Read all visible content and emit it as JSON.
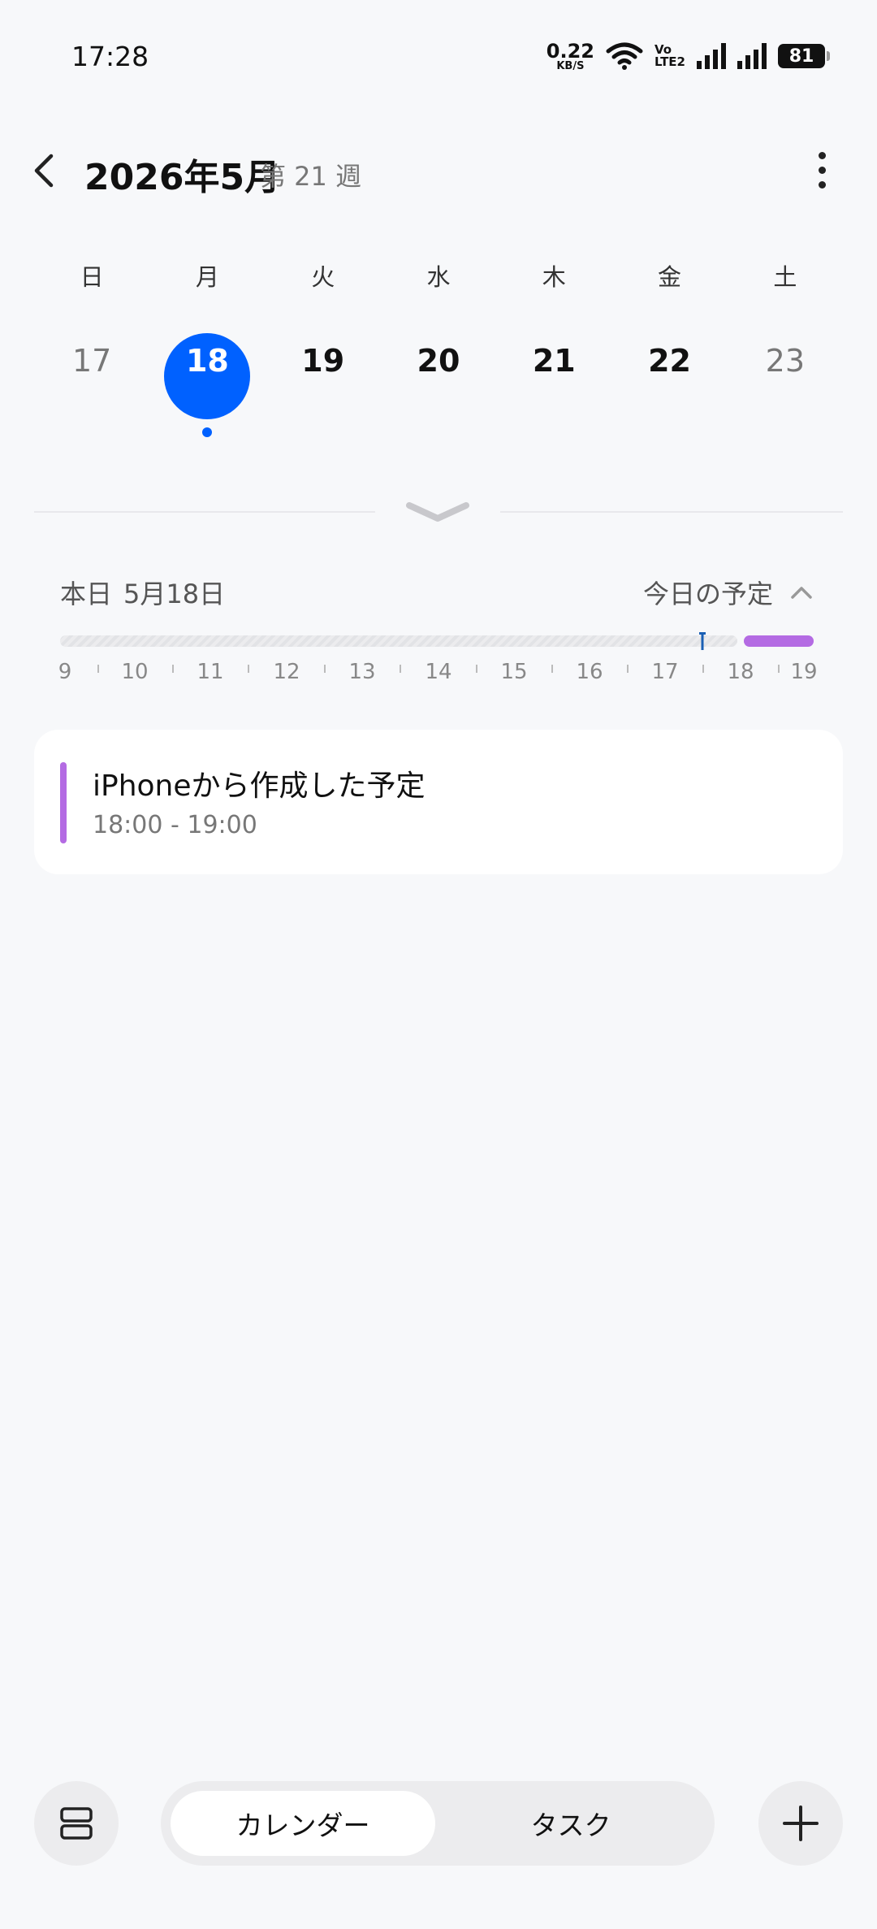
{
  "status": {
    "time": "17:28",
    "net_speed_value": "0.22",
    "net_speed_unit": "KB/S",
    "volte_top": "Vo",
    "volte_bottom": "LTE2",
    "battery": "81"
  },
  "header": {
    "title": "2026年5月",
    "week": "第 21 週"
  },
  "weekdays": [
    "日",
    "月",
    "火",
    "水",
    "木",
    "金",
    "土"
  ],
  "dates": [
    "17",
    "18",
    "19",
    "20",
    "21",
    "22",
    "23"
  ],
  "selected_date_index": 1,
  "today": {
    "label": "本日",
    "date": "5月18日",
    "schedule_toggle": "今日の予定"
  },
  "timeline": {
    "hours": [
      "9",
      "10",
      "11",
      "12",
      "13",
      "14",
      "15",
      "16",
      "17",
      "18",
      "19"
    ],
    "event_color": "#b46be3"
  },
  "events": [
    {
      "title": "iPhoneから作成した予定",
      "time": "18:00 - 19:00",
      "color": "#b46be3"
    }
  ],
  "bottom": {
    "tab_calendar": "カレンダー",
    "tab_tasks": "タスク"
  },
  "colors": {
    "accent": "#0061ff",
    "background": "#f7f8fa"
  }
}
